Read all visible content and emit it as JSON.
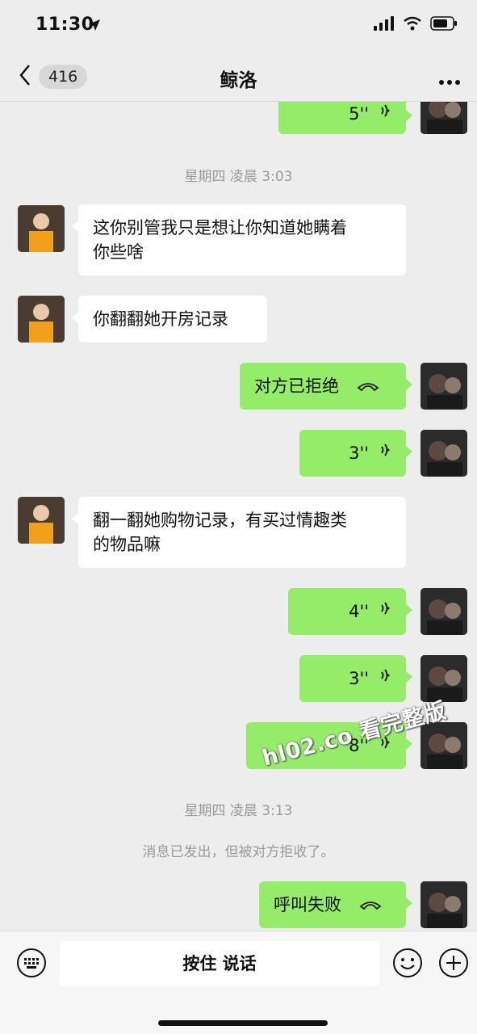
{
  "status": {
    "time": "11:30"
  },
  "nav": {
    "badge": "416",
    "title": "鲸洛"
  },
  "timestamps": [
    "星期四 凌晨 3:03",
    "星期四 凌晨 3:13"
  ],
  "messages": [
    {
      "side": "right",
      "type": "voice",
      "duration": "5''"
    },
    {
      "side": "left",
      "type": "text",
      "lines": [
        "这你别管我只是想让你知道她瞒着",
        "你些啥"
      ]
    },
    {
      "side": "left",
      "type": "text",
      "lines": [
        "你翻翻她开房记录"
      ]
    },
    {
      "side": "right",
      "type": "call",
      "text": "对方已拒绝"
    },
    {
      "side": "right",
      "type": "voice",
      "duration": "3''"
    },
    {
      "side": "left",
      "type": "text",
      "lines": [
        "翻一翻她购物记录，有买过情趣类",
        "的物品嘛"
      ]
    },
    {
      "side": "right",
      "type": "voice",
      "duration": "4''"
    },
    {
      "side": "right",
      "type": "voice",
      "duration": "3''"
    },
    {
      "side": "right",
      "type": "voice",
      "duration": "8''"
    },
    {
      "side": "right",
      "type": "call",
      "text": "呼叫失败"
    }
  ],
  "system_message": "消息已发出，但被对方拒收了。",
  "input": {
    "hold_to_talk": "按住 说话"
  },
  "watermark": "hl02.co 看完整版",
  "colors": {
    "self_bubble": "#95ec69",
    "other_bubble": "#ffffff",
    "background": "#ededed"
  },
  "icons": [
    "location-arrow-icon",
    "signal-icon",
    "wifi-icon",
    "battery-icon",
    "back-chevron-icon",
    "more-dots-icon",
    "voice-wave-icon",
    "phone-hangup-icon",
    "keyboard-icon",
    "emoji-icon",
    "plus-icon"
  ]
}
